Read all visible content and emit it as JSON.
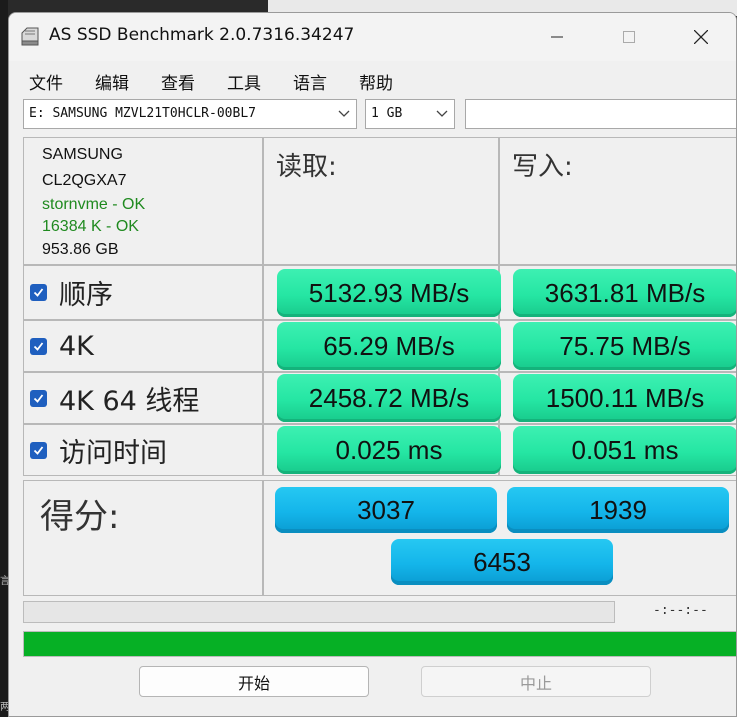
{
  "window": {
    "title": "AS SSD Benchmark 2.0.7316.34247"
  },
  "menu": [
    "文件",
    "编辑",
    "查看",
    "工具",
    "语言",
    "帮助"
  ],
  "drive_select": {
    "value": "E: SAMSUNG MZVL21T0HCLR-00BL7"
  },
  "size_select": {
    "value": "1 GB"
  },
  "drive_info": {
    "vendor": "SAMSUNG",
    "firmware": "CL2QGXA7",
    "driver": "stornvme - OK",
    "alignment": "16384 K - OK",
    "capacity": "953.86 GB"
  },
  "columns": {
    "read": "读取:",
    "write": "写入:"
  },
  "tests": [
    {
      "label": "顺序",
      "read": "5132.93 MB/s",
      "write": "3631.81 MB/s",
      "checked": true
    },
    {
      "label": "4K",
      "read": "65.29 MB/s",
      "write": "75.75 MB/s",
      "checked": true
    },
    {
      "label": "4K 64 线程",
      "read": "2458.72 MB/s",
      "write": "1500.11 MB/s",
      "checked": true
    },
    {
      "label": "访问时间",
      "read": "0.025 ms",
      "write": "0.051 ms",
      "checked": true
    }
  ],
  "score": {
    "label": "得分:",
    "read": "3037",
    "write": "1939",
    "total": "6453"
  },
  "progress": {
    "time": "-:--:--",
    "total_fill": 1.0
  },
  "buttons": {
    "start": "开始",
    "abort": "中止"
  },
  "background": {
    "glyph1": "言",
    "glyph2": "两"
  },
  "colors": {
    "result": "#25e6a3",
    "score": "#14b5ea",
    "progress": "#06b025",
    "ok_text": "#1f8a1f"
  }
}
